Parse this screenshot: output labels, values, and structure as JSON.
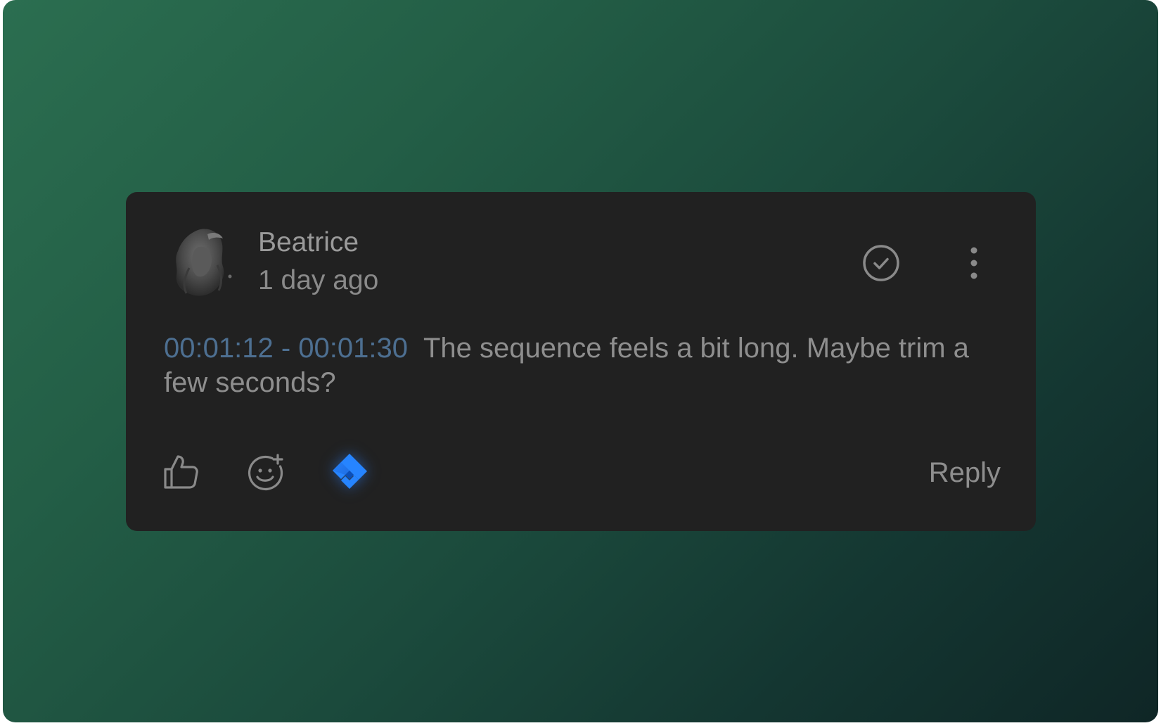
{
  "comment": {
    "author": "Beatrice",
    "time_ago": "1 day ago",
    "timecode": "00:01:12 - 00:01:30",
    "text": "The sequence feels a bit long. Maybe trim a few seconds?"
  },
  "actions": {
    "reply_label": "Reply"
  },
  "icons": {
    "resolve": "check-circle-icon",
    "more": "more-vertical-icon",
    "like": "thumbs-up-icon",
    "emoji": "add-emoji-icon",
    "integration": "jira-icon"
  },
  "colors": {
    "card_background": "#212121",
    "timecode": "#4d6f91",
    "text": "#8e8e8e",
    "jira_blue": "#2684ff",
    "background_start": "#2b6e50",
    "background_end": "#0f2626"
  }
}
